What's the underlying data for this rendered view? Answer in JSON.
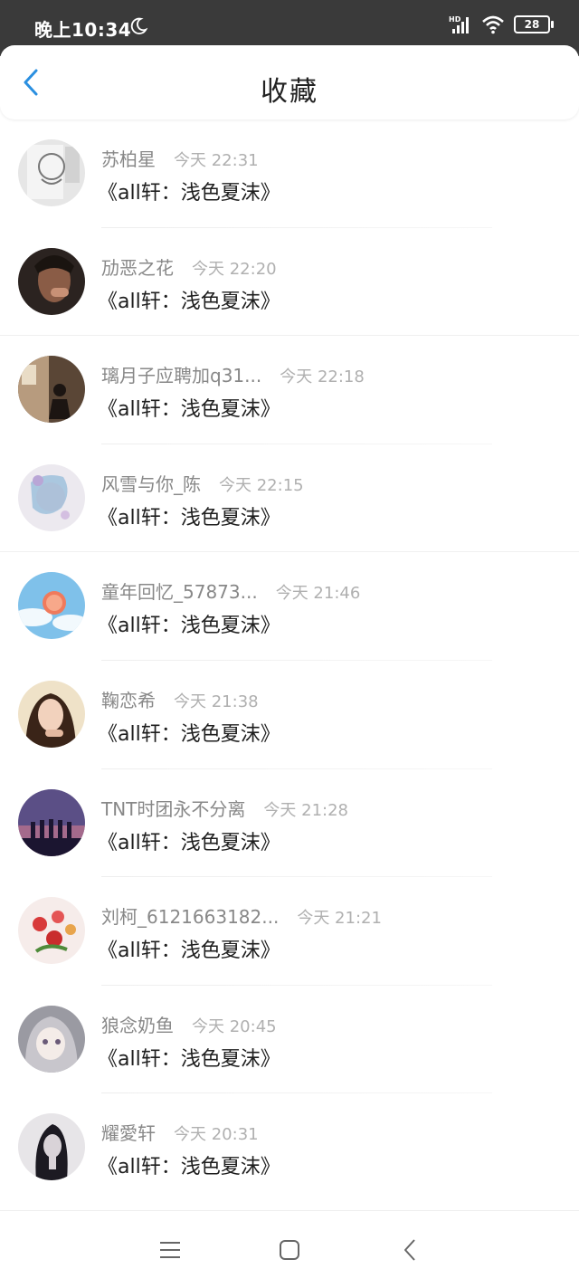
{
  "status_bar": {
    "time": "晚上10:34",
    "network": "HD",
    "battery": "28"
  },
  "header": {
    "title": "收藏"
  },
  "favorites": [
    {
      "user": "苏柏星",
      "time": "今天 22:31",
      "title": "《all轩：浅色夏沫》"
    },
    {
      "user": "劢恶之花",
      "time": "今天 22:20",
      "title": "《all轩：浅色夏沫》"
    },
    {
      "user": "璃月子应聘加q31...",
      "time": "今天 22:18",
      "title": "《all轩：浅色夏沫》"
    },
    {
      "user": "风雪与你_陈",
      "time": "今天 22:15",
      "title": "《all轩：浅色夏沫》"
    },
    {
      "user": "童年回忆_57873...",
      "time": "今天 21:46",
      "title": "《all轩：浅色夏沫》"
    },
    {
      "user": "鞠恋希",
      "time": "今天 21:38",
      "title": "《all轩：浅色夏沫》"
    },
    {
      "user": "TNT时团永不分离",
      "time": "今天 21:28",
      "title": "《all轩：浅色夏沫》"
    },
    {
      "user": "刘柯_6121663182...",
      "time": "今天 21:21",
      "title": "《all轩：浅色夏沫》"
    },
    {
      "user": "狼念奶鱼",
      "time": "今天 20:45",
      "title": "《all轩：浅色夏沫》"
    },
    {
      "user": "耀愛轩",
      "time": "今天 20:31",
      "title": "《all轩：浅色夏沫》"
    }
  ],
  "colors": {
    "status_bar": "#3a3a3a",
    "accent": "#2a8fe0",
    "username": "#888888",
    "timestamp": "#b0b0b0",
    "title_text": "#1e1e1e"
  },
  "icons": {
    "back": "chevron-left-icon",
    "nav_menu": "menu-icon",
    "nav_home": "square-icon",
    "nav_back": "back-arrow-icon"
  }
}
